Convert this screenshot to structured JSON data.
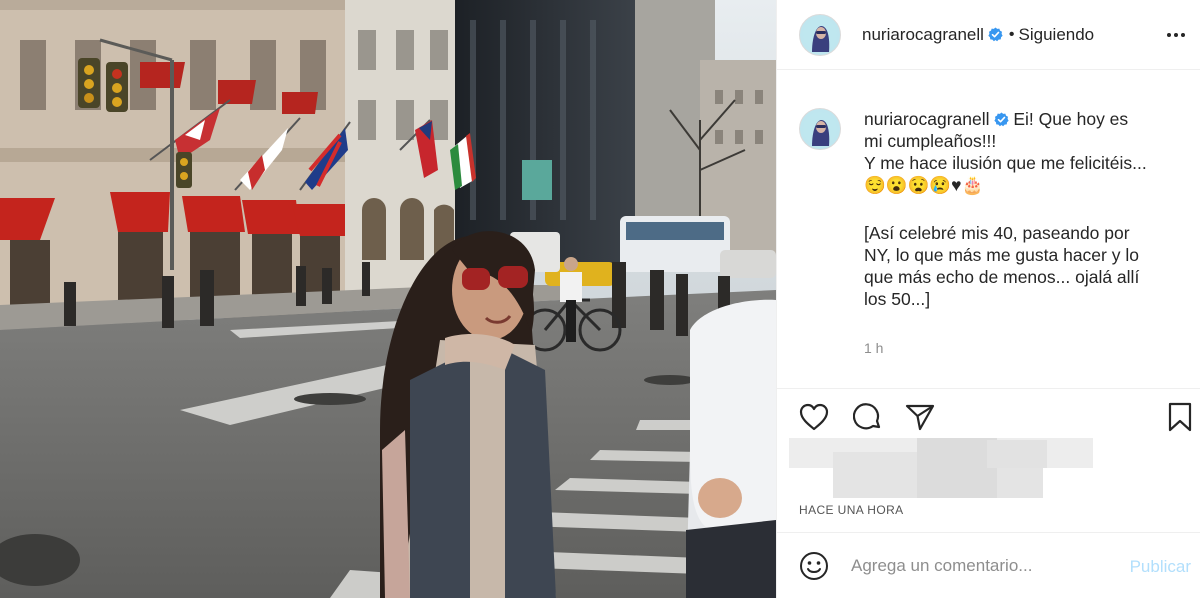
{
  "post": {
    "username": "nuriarocagranell",
    "verified_icon": "verified-badge-icon",
    "separator": "•",
    "follow_status": "Siguiendo",
    "more_icon": "more-options-icon"
  },
  "caption": {
    "username": "nuriarocagranell",
    "line1": "Ei! Que hoy es",
    "line2": "mi cumpleaños!!!",
    "line3": "Y me hace ilusión que me felicitéis...",
    "line4": "😌😮😧😢♥🎂",
    "line5": "[Así celebré mis 40, paseando por",
    "line6": "NY, lo que más me gusta hacer y lo",
    "line7": "que más echo de menos... ojalá allí",
    "line8": "los 50...]",
    "time": "1 h"
  },
  "actions": {
    "like_icon": "heart-icon",
    "comment_icon": "comment-icon",
    "share_icon": "paper-plane-icon",
    "save_icon": "bookmark-icon"
  },
  "timestamp": "HACE UNA HORA",
  "comment_box": {
    "emoji_icon": "emoji-icon",
    "placeholder": "Agrega un comentario...",
    "publish_label": "Publicar"
  },
  "colors": {
    "link_disabled": "#b2dffc",
    "verified": "#3897f0",
    "text": "#262626",
    "muted": "#8e8e8e",
    "border": "#efefef"
  }
}
